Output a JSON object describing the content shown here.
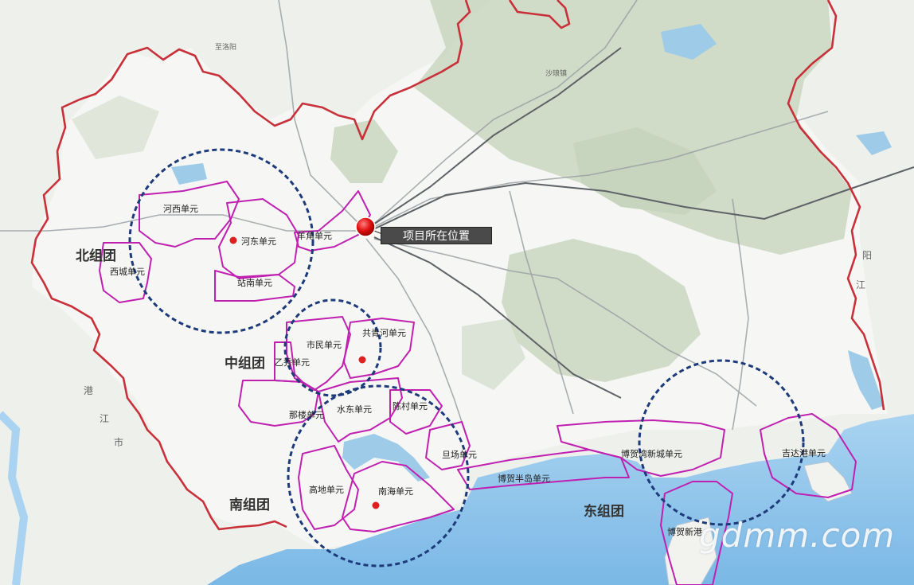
{
  "map": {
    "project_location": "项目所在位置",
    "watermark": "gdmm.com",
    "groups": {
      "north": "北组团",
      "middle": "中组团",
      "south": "南组团",
      "east": "东组团"
    },
    "units": {
      "hexi": "河西单元",
      "hedong": "河东单元",
      "xicheng": "西城单元",
      "zhannan": "站南单元",
      "yangjiao": "羊角单元",
      "shimin": "市民单元",
      "gongqinghe": "共青河单元",
      "yixiu": "乙秀单元",
      "nalou": "那楼单元",
      "shuidong": "水东单元",
      "chencun": "陈村单元",
      "danchang": "旦场单元",
      "bohebandao": "博贺半岛单元",
      "gaodi": "高地单元",
      "nanhai": "南海单元",
      "bohewanxincheng": "博贺湾新城单元",
      "jidagang": "吉达港单元",
      "bohexingang": "博贺新港"
    },
    "place_labels": {
      "zhiluoyang": "至洛阳",
      "shaluozhen": "沙琅镇",
      "rong": "阳",
      "jiang": "江",
      "gang": "港",
      "jiang2": "江",
      "shi": "市"
    },
    "colors": {
      "land": "#f4f5f2",
      "sea": "#8fc4ea",
      "mountain": "#c9d6c0",
      "boundary": "#c8303a",
      "unit_outline": "#c020b0",
      "circle": "#1d3a7a",
      "marker": "#e01010"
    }
  }
}
